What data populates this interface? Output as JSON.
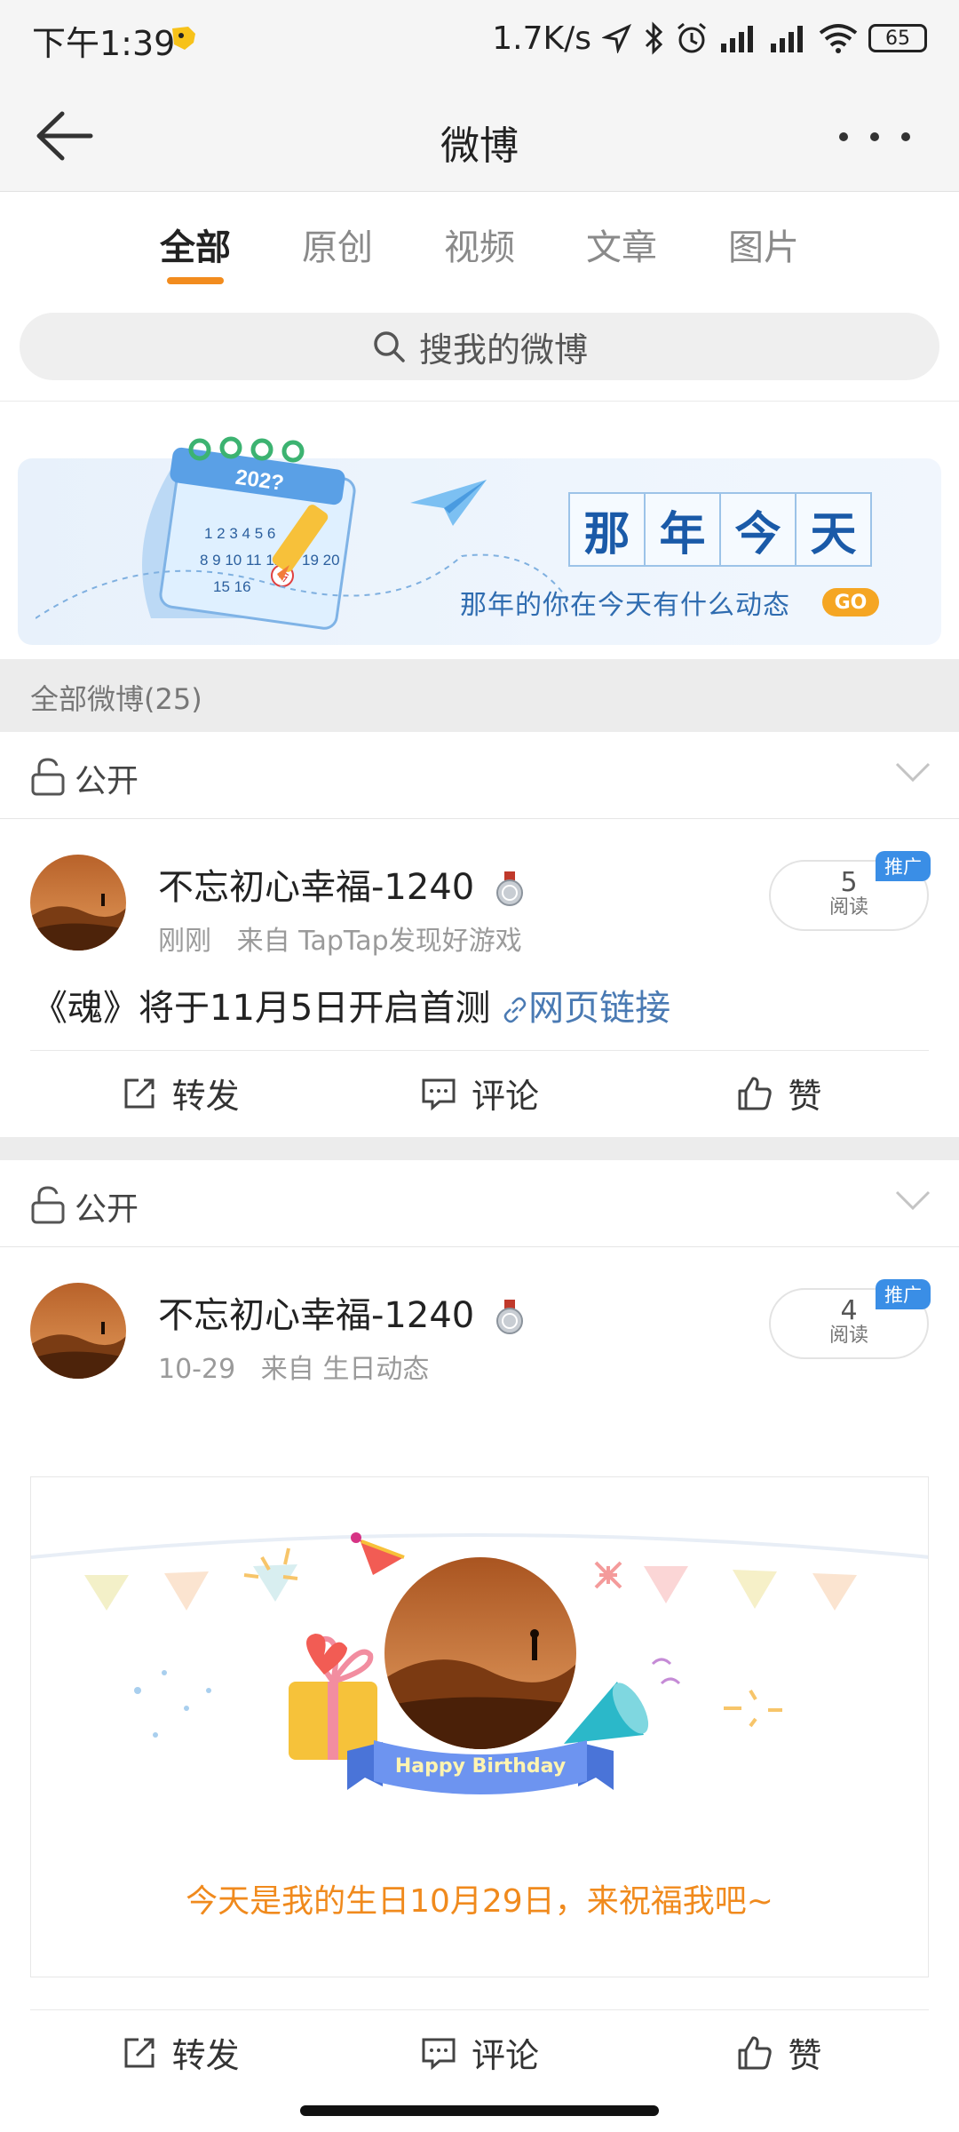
{
  "status_bar": {
    "time": "下午1:39",
    "net_speed": "1.7K/s",
    "battery": "65"
  },
  "nav": {
    "title": "微博"
  },
  "tabs": [
    {
      "label": "全部",
      "active": true
    },
    {
      "label": "原创",
      "active": false
    },
    {
      "label": "视频",
      "active": false
    },
    {
      "label": "文章",
      "active": false
    },
    {
      "label": "图片",
      "active": false
    }
  ],
  "search": {
    "placeholder": "搜我的微博"
  },
  "banner": {
    "calendar_year": "202?",
    "title_chars": [
      "那",
      "年",
      "今",
      "天"
    ],
    "subtitle": "那年的你在今天有什么动态",
    "go_label": "GO"
  },
  "section": {
    "header": "全部微博(25)"
  },
  "posts": [
    {
      "privacy": "公开",
      "username": "不忘初心幸福-1240",
      "time": "刚刚",
      "source": "来自 TapTap发现好游戏",
      "read_count": "5",
      "read_label": "阅读",
      "promo_tag": "推广",
      "text": "《魂》将于11月5日开启首测",
      "link_text": "网页链接",
      "actions": {
        "repost": "转发",
        "comment": "评论",
        "like": "赞"
      }
    },
    {
      "privacy": "公开",
      "username": "不忘初心幸福-1240",
      "time": "10-29",
      "source": "来自 生日动态",
      "read_count": "4",
      "read_label": "阅读",
      "promo_tag": "推广",
      "card": {
        "ribbon_text": "Happy Birthday",
        "message": "今天是我的生日10月29日，来祝福我吧~"
      },
      "actions": {
        "repost": "转发",
        "comment": "评论",
        "like": "赞"
      }
    }
  ],
  "colors": {
    "accent": "#f28c1e",
    "link": "#4a7ab3",
    "banner_blue": "#1a5aa8",
    "promo_blue": "#3a8ee6"
  }
}
